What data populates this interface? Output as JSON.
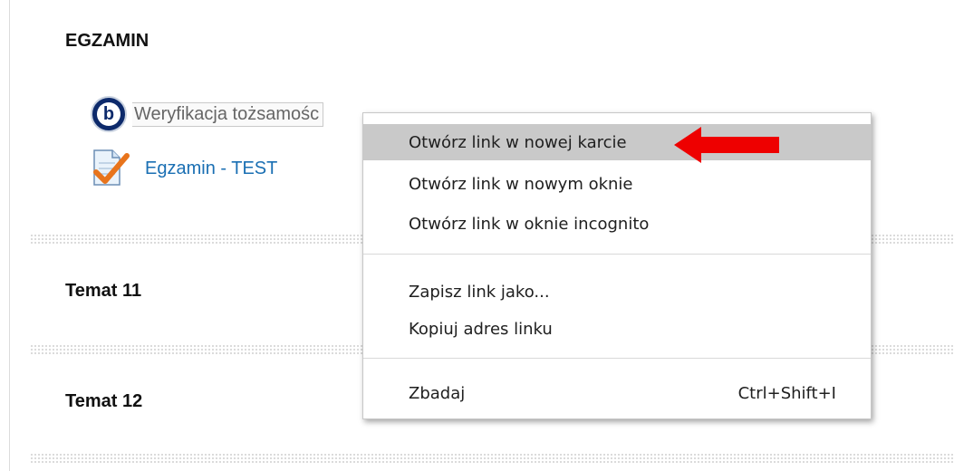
{
  "sections": {
    "egzamin": "EGZAMIN",
    "temat11": "Temat 11",
    "temat12": "Temat 12"
  },
  "activities": {
    "verification": {
      "label": "Weryfikacja tożsamośc",
      "icon": "bigbluebutton-icon"
    },
    "exam": {
      "label": "Egzamin - TEST",
      "icon": "quiz-checkmark-icon"
    }
  },
  "context_menu": {
    "items": [
      {
        "label": "Otwórz link w nowej karcie",
        "highlighted": true
      },
      {
        "label": "Otwórz link w nowym oknie"
      },
      {
        "label": "Otwórz link w oknie incognito"
      },
      {
        "label": "Zapisz link jako..."
      },
      {
        "label": "Kopiuj adres linku"
      },
      {
        "label": "Zbadaj",
        "shortcut": "Ctrl+Shift+I"
      }
    ]
  },
  "colors": {
    "link": "#1a6fb3",
    "menu_highlight": "#c9c9c9",
    "annotation_arrow": "#ee0000"
  }
}
